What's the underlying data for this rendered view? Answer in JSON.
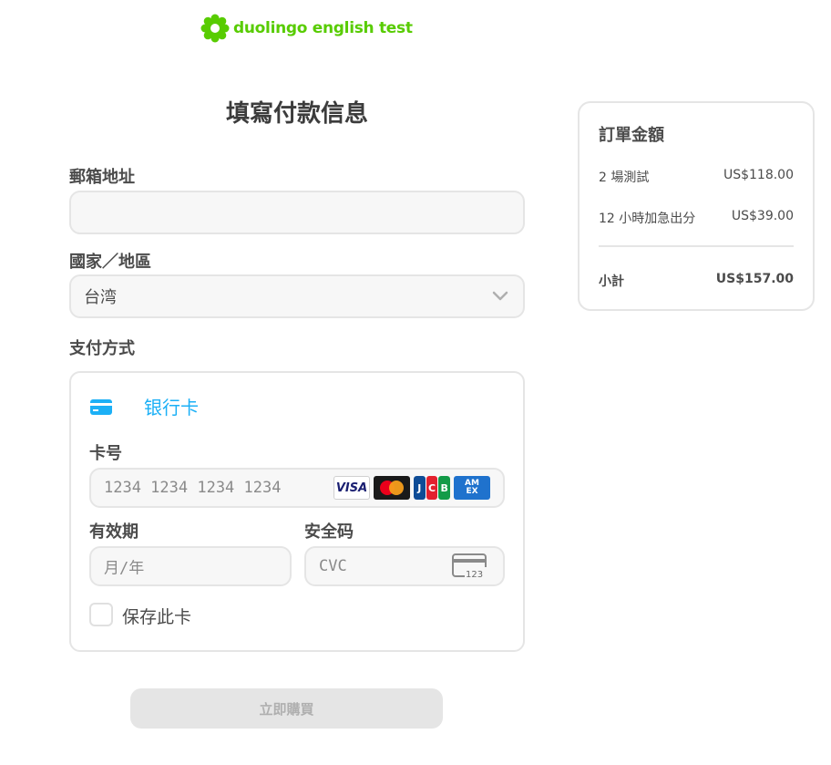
{
  "brand": {
    "name": "duolingo english test",
    "color": "#58cc02"
  },
  "page": {
    "title": "填寫付款信息"
  },
  "form": {
    "email_label": "郵箱地址",
    "email_value": "",
    "country_label": "國家／地區",
    "country_value": "台湾",
    "payment_method_label": "支付方式",
    "payment_option": "银行卡",
    "card_number_label": "卡号",
    "card_number_placeholder": "1234 1234 1234 1234",
    "card_brands": [
      "VISA",
      "Mastercard",
      "JCB",
      "AMEX"
    ],
    "expiry_label": "有效期",
    "expiry_placeholder": "月/年",
    "cvc_label": "安全码",
    "cvc_placeholder": "CVC",
    "cvc_icon_text": "123",
    "save_card_label": "保存此卡",
    "save_card_checked": false,
    "submit_label": "立即購買"
  },
  "summary": {
    "title": "訂單金額",
    "items": [
      {
        "label": "2 場測試",
        "amount": "US$118.00"
      },
      {
        "label": "12 小時加急出分",
        "amount": "US$39.00"
      }
    ],
    "subtotal_label": "小計",
    "subtotal_amount": "US$157.00"
  },
  "colors": {
    "accent_blue": "#1cb0f6",
    "border": "#e5e5e5",
    "input_bg": "#f7f7f7"
  }
}
